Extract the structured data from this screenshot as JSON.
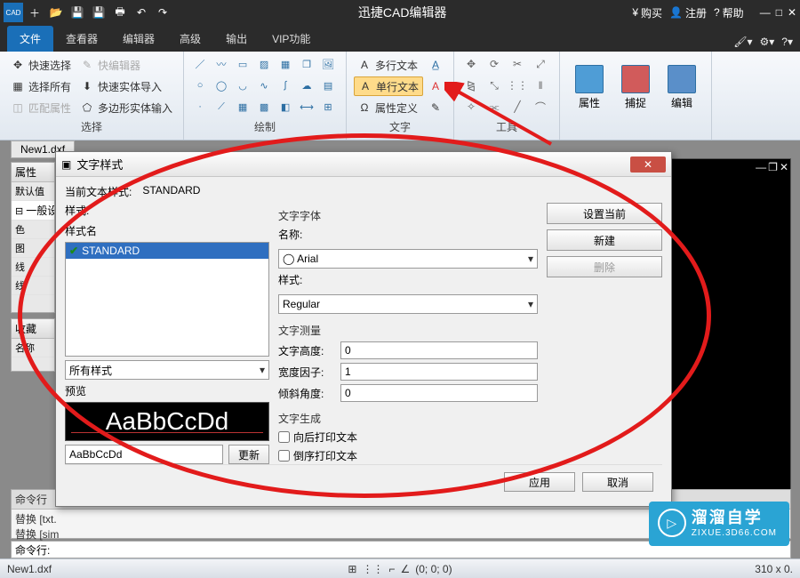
{
  "app": {
    "title": "迅捷CAD编辑器"
  },
  "titlebar": {
    "buy": "购买",
    "register": "注册",
    "help": "帮助"
  },
  "menu": {
    "tabs": [
      "文件",
      "查看器",
      "编辑器",
      "高级",
      "输出",
      "VIP功能"
    ],
    "active": 0
  },
  "ribbon": {
    "select": {
      "label": "选择",
      "quick_select": "快速选择",
      "quick_editor": "快编辑器",
      "select_all": "选择所有",
      "quick_solid_import": "快速实体导入",
      "match_props": "匹配属性",
      "poly_solid_input": "多边形实体输入"
    },
    "draw": {
      "label": "绘制"
    },
    "text": {
      "label": "文字",
      "multiline": "多行文本",
      "singleline": "单行文本",
      "attr_def": "属性定义"
    },
    "tool": {
      "label": "工具"
    },
    "attrs": {
      "label": "属性"
    },
    "snap": {
      "label": "捕捉"
    },
    "edit": {
      "label": "编辑"
    }
  },
  "workspace": {
    "file_tab": "New1.dxf",
    "left": {
      "props": "属性",
      "default": "默认值",
      "general": "一般设",
      "color": "色",
      "layer": "图",
      "ltype": "线",
      "lweight": "线",
      "fav": "收藏",
      "name": "名称"
    },
    "cmd_header": "命令行",
    "cmd1": "替换 [txt.",
    "cmd2": "替换 [sim",
    "cmd_prompt": "命令行:"
  },
  "status": {
    "file": "New1.dxf",
    "coords": "(0; 0; 0)",
    "dims": "310 x 0."
  },
  "dialog": {
    "title": "文字样式",
    "current_label": "当前文本样式:",
    "current_value": "STANDARD",
    "styles_label": "样式:",
    "style_name_col": "样式名",
    "style_item": "STANDARD",
    "all_styles": "所有样式",
    "preview_label": "预览",
    "preview_big": "AaBbCcDd",
    "preview_input": "AaBbCcDd",
    "update_btn": "更新",
    "font_group": "文字字体",
    "font_name_label": "名称:",
    "font_name_value": "Arial",
    "font_style_label": "样式:",
    "font_style_value": "Regular",
    "measure_group": "文字测量",
    "height_label": "文字高度:",
    "height_value": "0",
    "width_label": "宽度因子:",
    "width_value": "1",
    "oblique_label": "倾斜角度:",
    "oblique_value": "0",
    "gen_group": "文字生成",
    "backwards": "向后打印文本",
    "upsidedown": "倒序打印文本",
    "set_current": "设置当前",
    "new_btn": "新建",
    "delete_btn": "删除",
    "apply": "应用",
    "cancel": "取消"
  },
  "watermark": {
    "big": "溜溜自学",
    "small": "ZIXUE.3D66.COM"
  }
}
